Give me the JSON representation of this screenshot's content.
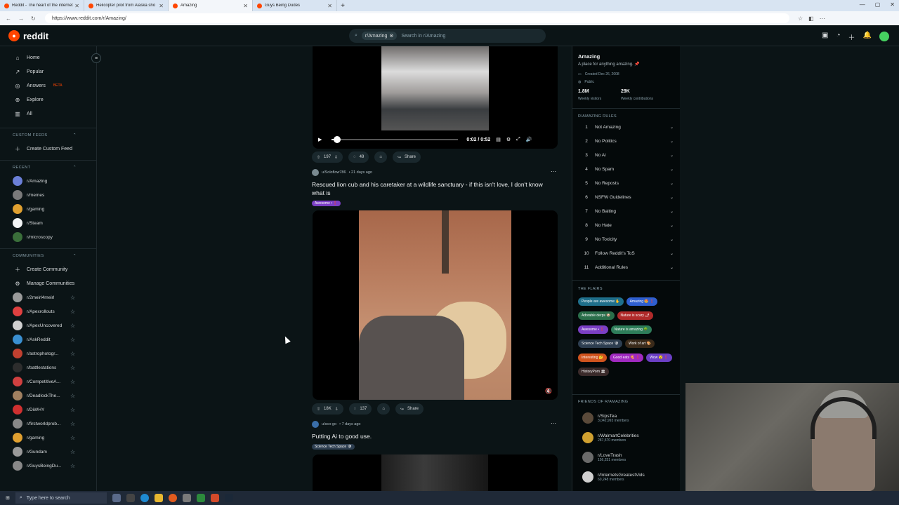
{
  "browser": {
    "tabs": [
      {
        "label": "Reddit - The heart of the internet",
        "active": false
      },
      {
        "label": "Helicopter pilot from Alaska sho",
        "active": false
      },
      {
        "label": "Amazing",
        "active": true
      },
      {
        "label": "Guys Being Dudes",
        "active": false
      }
    ],
    "url": "https://www.reddit.com/r/Amazing/"
  },
  "header": {
    "logo_text": "reddit",
    "search_chip": "r/Amazing",
    "search_placeholder": "Search in r/Amazing"
  },
  "sidebar": {
    "nav": [
      {
        "label": "Home",
        "icon": "home-icon",
        "glyph": "⌂"
      },
      {
        "label": "Popular",
        "icon": "popular-icon",
        "glyph": "↗"
      },
      {
        "label": "Answers",
        "icon": "answers-icon",
        "glyph": "◎"
      },
      {
        "label": "Explore",
        "icon": "explore-icon",
        "glyph": "⊕"
      },
      {
        "label": "All",
        "icon": "all-icon",
        "glyph": "▥"
      }
    ],
    "answers_badge": "BETA",
    "custom_feeds_header": "CUSTOM FEEDS",
    "create_custom_feed": "Create Custom Feed",
    "recent_header": "RECENT",
    "recent": [
      {
        "label": "r/Amazing",
        "color": "#6b7fd7"
      },
      {
        "label": "r/memes",
        "color": "#7a7a7a"
      },
      {
        "label": "r/gaming",
        "color": "#e0a030"
      },
      {
        "label": "r/Steam",
        "color": "#f2f4f5"
      },
      {
        "label": "r/microscopy",
        "color": "#3a6e3a"
      }
    ],
    "communities_header": "COMMUNITIES",
    "create_community": "Create Community",
    "manage_communities": "Manage Communities",
    "communities": [
      {
        "label": "r/2meirl4meirl",
        "color": "#9a9a9a"
      },
      {
        "label": "r/Apexrollouts",
        "color": "#e04040"
      },
      {
        "label": "r/ApexUncovered",
        "color": "#d0d0d0"
      },
      {
        "label": "r/AskReddit",
        "color": "#3a8fd0"
      },
      {
        "label": "r/astrophotogr...",
        "color": "#c04030"
      },
      {
        "label": "r/battlestations",
        "color": "#2d2d2d"
      },
      {
        "label": "r/CompetitiveA...",
        "color": "#d04040"
      },
      {
        "label": "r/DeadlockThe...",
        "color": "#a08060"
      },
      {
        "label": "r/DiWHY",
        "color": "#d03030"
      },
      {
        "label": "r/firstworldprob...",
        "color": "#888888"
      },
      {
        "label": "r/gaming",
        "color": "#e0a030"
      },
      {
        "label": "r/Gundam",
        "color": "#9a9a9a"
      },
      {
        "label": "r/GuysBeingDu...",
        "color": "#888888"
      }
    ]
  },
  "player": {
    "time": "0:02 / 0:52",
    "progress": 0.04
  },
  "posts": [
    {
      "votes": "197",
      "comments": "49",
      "share": "Share"
    },
    {
      "author": "u/Soloflow786",
      "age": "• 21 days ago",
      "title": "Rescued lion cub and his caretaker at a wildlife sanctuary - if this isn't love, I don't know what is",
      "flair": "Awesome • ❗",
      "flair_color": "#7b3fc4",
      "votes": "18K",
      "comments": "137",
      "share": "Share"
    },
    {
      "author": "u/sco-go",
      "age": "• 7 days ago",
      "title": "Putting Ai to good use.",
      "flair": "Science Tech Space 🛡",
      "flair_color": "#2d3e50"
    }
  ],
  "community": {
    "name": "Amazing",
    "description": "A place for anything amazing. 📌",
    "created": "Created Dec 26, 2008",
    "visibility": "Public",
    "visitors": "1.8M",
    "visitors_label": "Weekly visitors",
    "contributions": "29K",
    "contributions_label": "Weekly contributions",
    "rules_header": "R/AMAZING RULES",
    "rules": [
      {
        "num": "1",
        "label": "Not Amazing"
      },
      {
        "num": "2",
        "label": "No Politics"
      },
      {
        "num": "3",
        "label": "No Ai"
      },
      {
        "num": "4",
        "label": "No Spam"
      },
      {
        "num": "5",
        "label": "No Reposts"
      },
      {
        "num": "6",
        "label": "NSFW Guidelines"
      },
      {
        "num": "7",
        "label": "No Baiting"
      },
      {
        "num": "8",
        "label": "No Hate"
      },
      {
        "num": "9",
        "label": "No Toxicity"
      },
      {
        "num": "10",
        "label": "Follow Reddit's ToS"
      },
      {
        "num": "11",
        "label": "Additional Rules"
      }
    ],
    "flairs_header": "THE FLAIRS",
    "flairs": [
      {
        "label": "People are awesome ✋",
        "color": "#1f6f8b"
      },
      {
        "label": "Amazing 🤩 ❗",
        "color": "#2f5fd0"
      },
      {
        "label": "Adorable derps 🐶",
        "color": "#2a6e4a"
      },
      {
        "label": "Nature is scary 🌶",
        "color": "#b02a2a"
      },
      {
        "label": "Awesome • ❗",
        "color": "#7b3fc4"
      },
      {
        "label": "Nature is amazing 🌳",
        "color": "#2e7d5a"
      },
      {
        "label": "Science Tech Space 🛡",
        "color": "#2d3e50"
      },
      {
        "label": "Work of art 🎨",
        "color": "#3a2a1a"
      },
      {
        "label": "Interesting 🤔",
        "color": "#d0541e"
      },
      {
        "label": "Good eats 🍕 ❗",
        "color": "#a02ac0"
      },
      {
        "label": "Wow 😮 ❗",
        "color": "#6b3fc4"
      },
      {
        "label": "HistoryPorn 🏛",
        "color": "#3a2a2a"
      }
    ],
    "friends_header": "FRIENDS OF R/AMAZING",
    "friends": [
      {
        "name": "r/SipsTea",
        "members": "3,042,993 members",
        "color": "#5a4a3a"
      },
      {
        "name": "r/WalmartCelebrities",
        "members": "287,570 members",
        "color": "#d0a030"
      },
      {
        "name": "r/LoveTrash",
        "members": "156,251 members",
        "color": "#6a6a6a"
      },
      {
        "name": "r/InternetsGreatestVids",
        "members": "60,248 members",
        "color": "#d0d0d0"
      }
    ]
  },
  "taskbar": {
    "search_placeholder": "Type here to search"
  }
}
